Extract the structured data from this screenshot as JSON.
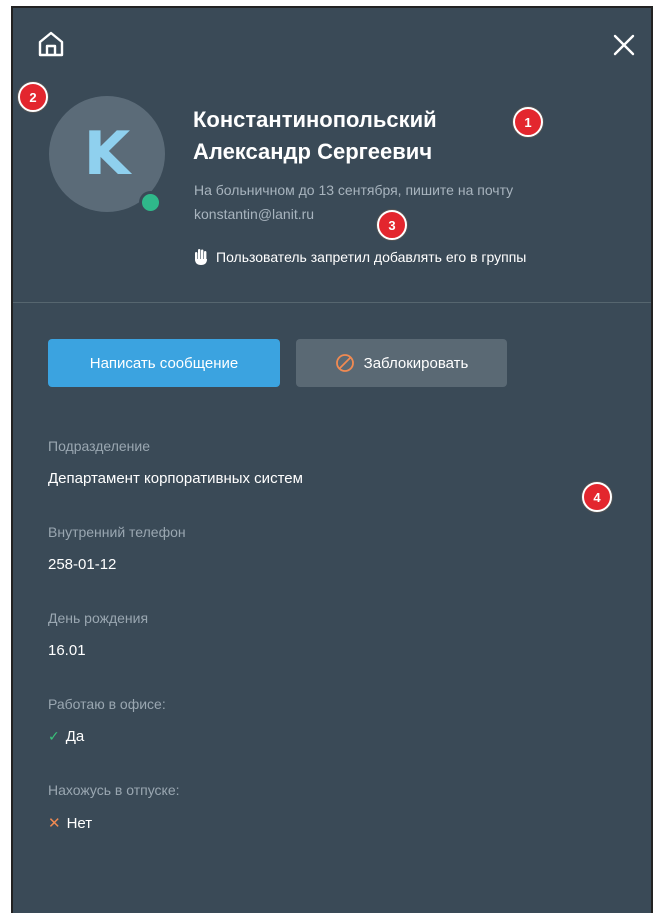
{
  "profile": {
    "avatar_letter": "K",
    "name_line1": "Константинопольский",
    "name_line2": "Александр Сергеевич",
    "status_line1": "На больничном до 13 сентября, пишите на почту",
    "status_line2": "konstantin@lanit.ru",
    "restriction": "Пользователь запретил добавлять его в группы",
    "online": true
  },
  "actions": {
    "message_label": "Написать сообщение",
    "block_label": "Заблокировать"
  },
  "fields": {
    "department": {
      "label": "Подразделение",
      "value": "Департамент корпоративных систем"
    },
    "phone": {
      "label": "Внутренний телефон",
      "value": "258-01-12"
    },
    "birthday": {
      "label": "День рождения",
      "value": "16.01"
    },
    "office": {
      "label": "Работаю в офисе:",
      "value": "Да",
      "icon": "check-icon"
    },
    "vacation": {
      "label": "Нахожусь в отпуске:",
      "value": "Нет",
      "icon": "cross-icon"
    }
  },
  "markers": [
    "1",
    "2",
    "3",
    "4"
  ],
  "colors": {
    "panel_bg": "#3a4a57",
    "primary": "#3ba3e0",
    "secondary": "#5a6974",
    "online": "#2fb88a",
    "avatar_letter": "#8fd0ee",
    "marker": "#e3262e"
  },
  "icons": {
    "home": "home-icon",
    "close": "close-icon",
    "hand": "hand-icon",
    "block": "block-icon"
  }
}
